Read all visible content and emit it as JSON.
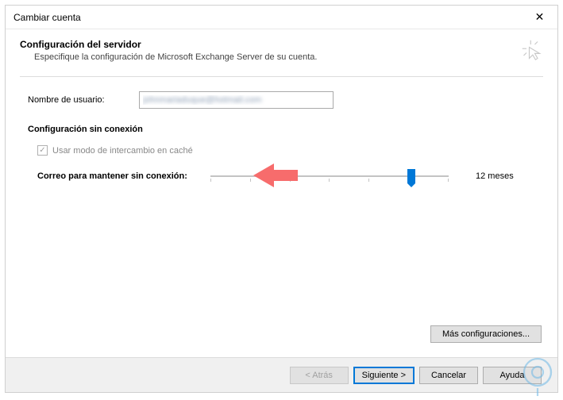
{
  "window": {
    "title": "Cambiar cuenta"
  },
  "header": {
    "title": "Configuración del servidor",
    "subtitle": "Especifique la configuración de Microsoft Exchange Server de su cuenta."
  },
  "form": {
    "username_label": "Nombre de usuario:",
    "username_value": "johnmariaduque@hotmail.com"
  },
  "offline": {
    "section_title": "Configuración sin conexión",
    "cache_mode_label": "Usar modo de intercambio en caché",
    "cache_mode_checked": true,
    "slider_label": "Correo para mantener sin conexión:",
    "slider_value_label": "12 meses"
  },
  "buttons": {
    "more": "Más configuraciones...",
    "back": "< Atrás",
    "next": "Siguiente >",
    "cancel": "Cancelar",
    "help": "Ayuda"
  }
}
